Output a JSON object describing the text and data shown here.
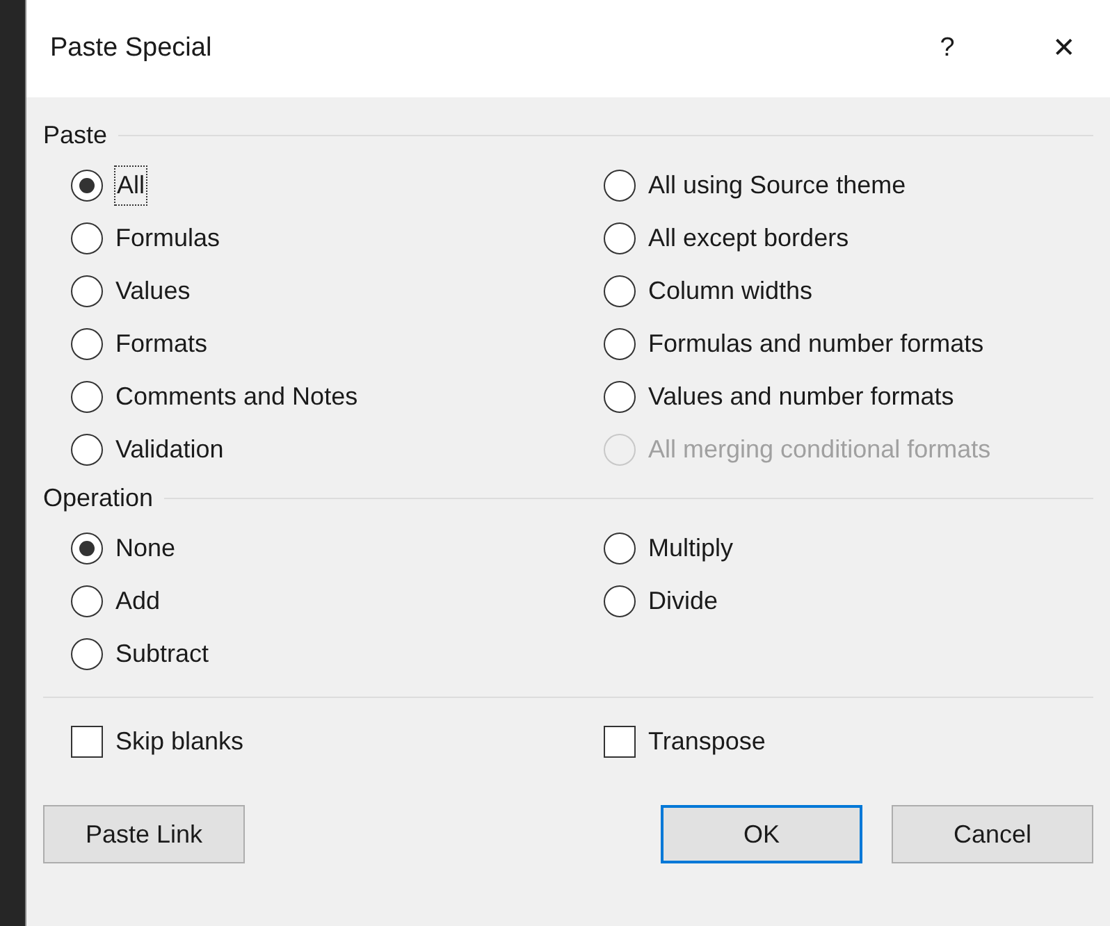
{
  "dialog": {
    "title": "Paste Special",
    "help": "?",
    "close": "✕"
  },
  "paste": {
    "label": "Paste",
    "options": [
      {
        "label": "All",
        "selected": true,
        "disabled": false,
        "focused": true
      },
      {
        "label": "Formulas",
        "selected": false,
        "disabled": false,
        "focused": false
      },
      {
        "label": "Values",
        "selected": false,
        "disabled": false,
        "focused": false
      },
      {
        "label": "Formats",
        "selected": false,
        "disabled": false,
        "focused": false
      },
      {
        "label": "Comments and Notes",
        "selected": false,
        "disabled": false,
        "focused": false
      },
      {
        "label": "Validation",
        "selected": false,
        "disabled": false,
        "focused": false
      },
      {
        "label": "All using Source theme",
        "selected": false,
        "disabled": false,
        "focused": false
      },
      {
        "label": "All except borders",
        "selected": false,
        "disabled": false,
        "focused": false
      },
      {
        "label": "Column widths",
        "selected": false,
        "disabled": false,
        "focused": false
      },
      {
        "label": "Formulas and number formats",
        "selected": false,
        "disabled": false,
        "focused": false
      },
      {
        "label": "Values and number formats",
        "selected": false,
        "disabled": false,
        "focused": false
      },
      {
        "label": "All merging conditional formats",
        "selected": false,
        "disabled": true,
        "focused": false
      }
    ]
  },
  "operation": {
    "label": "Operation",
    "options": [
      {
        "label": "None",
        "selected": true
      },
      {
        "label": "Add",
        "selected": false
      },
      {
        "label": "Subtract",
        "selected": false
      },
      {
        "label": "Multiply",
        "selected": false
      },
      {
        "label": "Divide",
        "selected": false
      }
    ]
  },
  "checkboxes": [
    {
      "label": "Skip blanks",
      "checked": false
    },
    {
      "label": "Transpose",
      "checked": false
    }
  ],
  "buttons": [
    {
      "label": "Paste Link",
      "default": false
    },
    {
      "label": "OK",
      "default": true
    },
    {
      "label": "Cancel",
      "default": false
    }
  ]
}
